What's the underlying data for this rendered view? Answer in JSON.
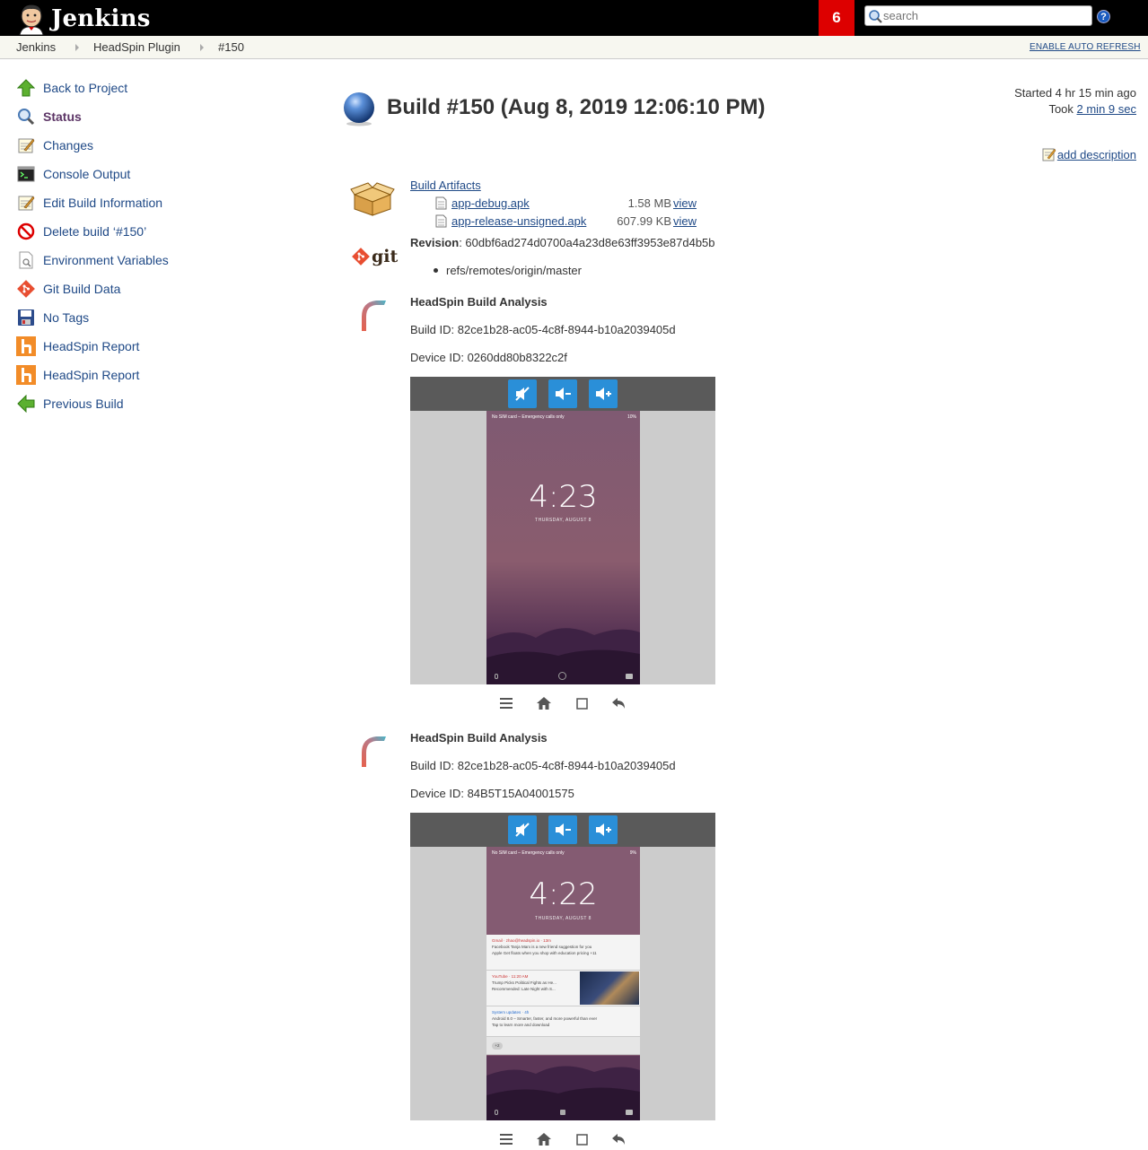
{
  "header": {
    "app_title": "Jenkins",
    "notification_count": "6",
    "search_placeholder": "search",
    "help_label": "?"
  },
  "breadcrumb": {
    "items": [
      "Jenkins",
      "HeadSpin Plugin",
      "#150"
    ],
    "auto_refresh": "ENABLE AUTO REFRESH"
  },
  "sidebar": {
    "items": [
      {
        "label": "Back to Project",
        "icon": "up-arrow-icon"
      },
      {
        "label": "Status",
        "icon": "magnifier-icon"
      },
      {
        "label": "Changes",
        "icon": "notepad-icon"
      },
      {
        "label": "Console Output",
        "icon": "terminal-icon"
      },
      {
        "label": "Edit Build Information",
        "icon": "notepad-icon"
      },
      {
        "label": "Delete build ‘#150’",
        "icon": "no-entry-icon"
      },
      {
        "label": "Environment Variables",
        "icon": "document-magnifier-icon"
      },
      {
        "label": "Git Build Data",
        "icon": "git-icon"
      },
      {
        "label": "No Tags",
        "icon": "floppy-disk-icon"
      },
      {
        "label": "HeadSpin Report",
        "icon": "headspin-icon"
      },
      {
        "label": "HeadSpin Report",
        "icon": "headspin-icon"
      },
      {
        "label": "Previous Build",
        "icon": "left-arrow-icon"
      }
    ]
  },
  "build": {
    "title": "Build #150 (Aug 8, 2019 12:06:10 PM)",
    "status_color": "#3465a4",
    "started": "Started 4 hr 15 min ago",
    "took_prefix": "Took ",
    "took_link": "2 min 9 sec",
    "add_description": "add description"
  },
  "artifacts": {
    "heading": "Build Artifacts",
    "files": [
      {
        "name": "app-debug.apk",
        "size": "1.58 MB",
        "view": "view"
      },
      {
        "name": "app-release-unsigned.apk",
        "size": "607.99 KB",
        "view": "view"
      }
    ]
  },
  "git": {
    "logo_text": "git",
    "revision_label": "Revision",
    "revision_value": ": 60dbf6ad274d0700a4a23d8e63ff3953e87d4b5b",
    "ref": "refs/remotes/origin/master"
  },
  "headspin": [
    {
      "title": "HeadSpin Build Analysis",
      "build_id": "Build ID: 82ce1b28-ac05-4c8f-8944-b10a2039405d",
      "device_id": "Device ID: 0260dd80b8322c2f",
      "screen": {
        "status_left": "No SIM card – Emergency calls only",
        "status_right": "10%",
        "time": "4:23",
        "date": "THURSDAY, AUGUST 8"
      }
    },
    {
      "title": "HeadSpin Build Analysis",
      "build_id": "Build ID: 82ce1b28-ac05-4c8f-8944-b10a2039405d",
      "device_id": "Device ID: 84B5T15A04001575",
      "screen": {
        "status_left": "No SIM card – Emergency calls only",
        "status_right": "9%",
        "time": "4:22",
        "date": "THURSDAY, AUGUST 8",
        "notifications": [
          {
            "app": "Gmail · zhao@headspin.io · 13m",
            "line1": "Facebook  Tanja Marx is a new friend suggestion for you",
            "line2": "Apple  Get floats when you shop with education pricing  +11"
          },
          {
            "app": "YouTube · 11:20 AM",
            "line1": "Trump Picks Political Fights as He...",
            "line2": "Recommended: Late Night with S..."
          },
          {
            "app": "System updates · 4h",
            "line1": "Android 8.0 – Smarter, faster, and more powerful than ever",
            "line2": "Tap to learn more and download"
          }
        ],
        "more_badge": "+2"
      }
    }
  ]
}
